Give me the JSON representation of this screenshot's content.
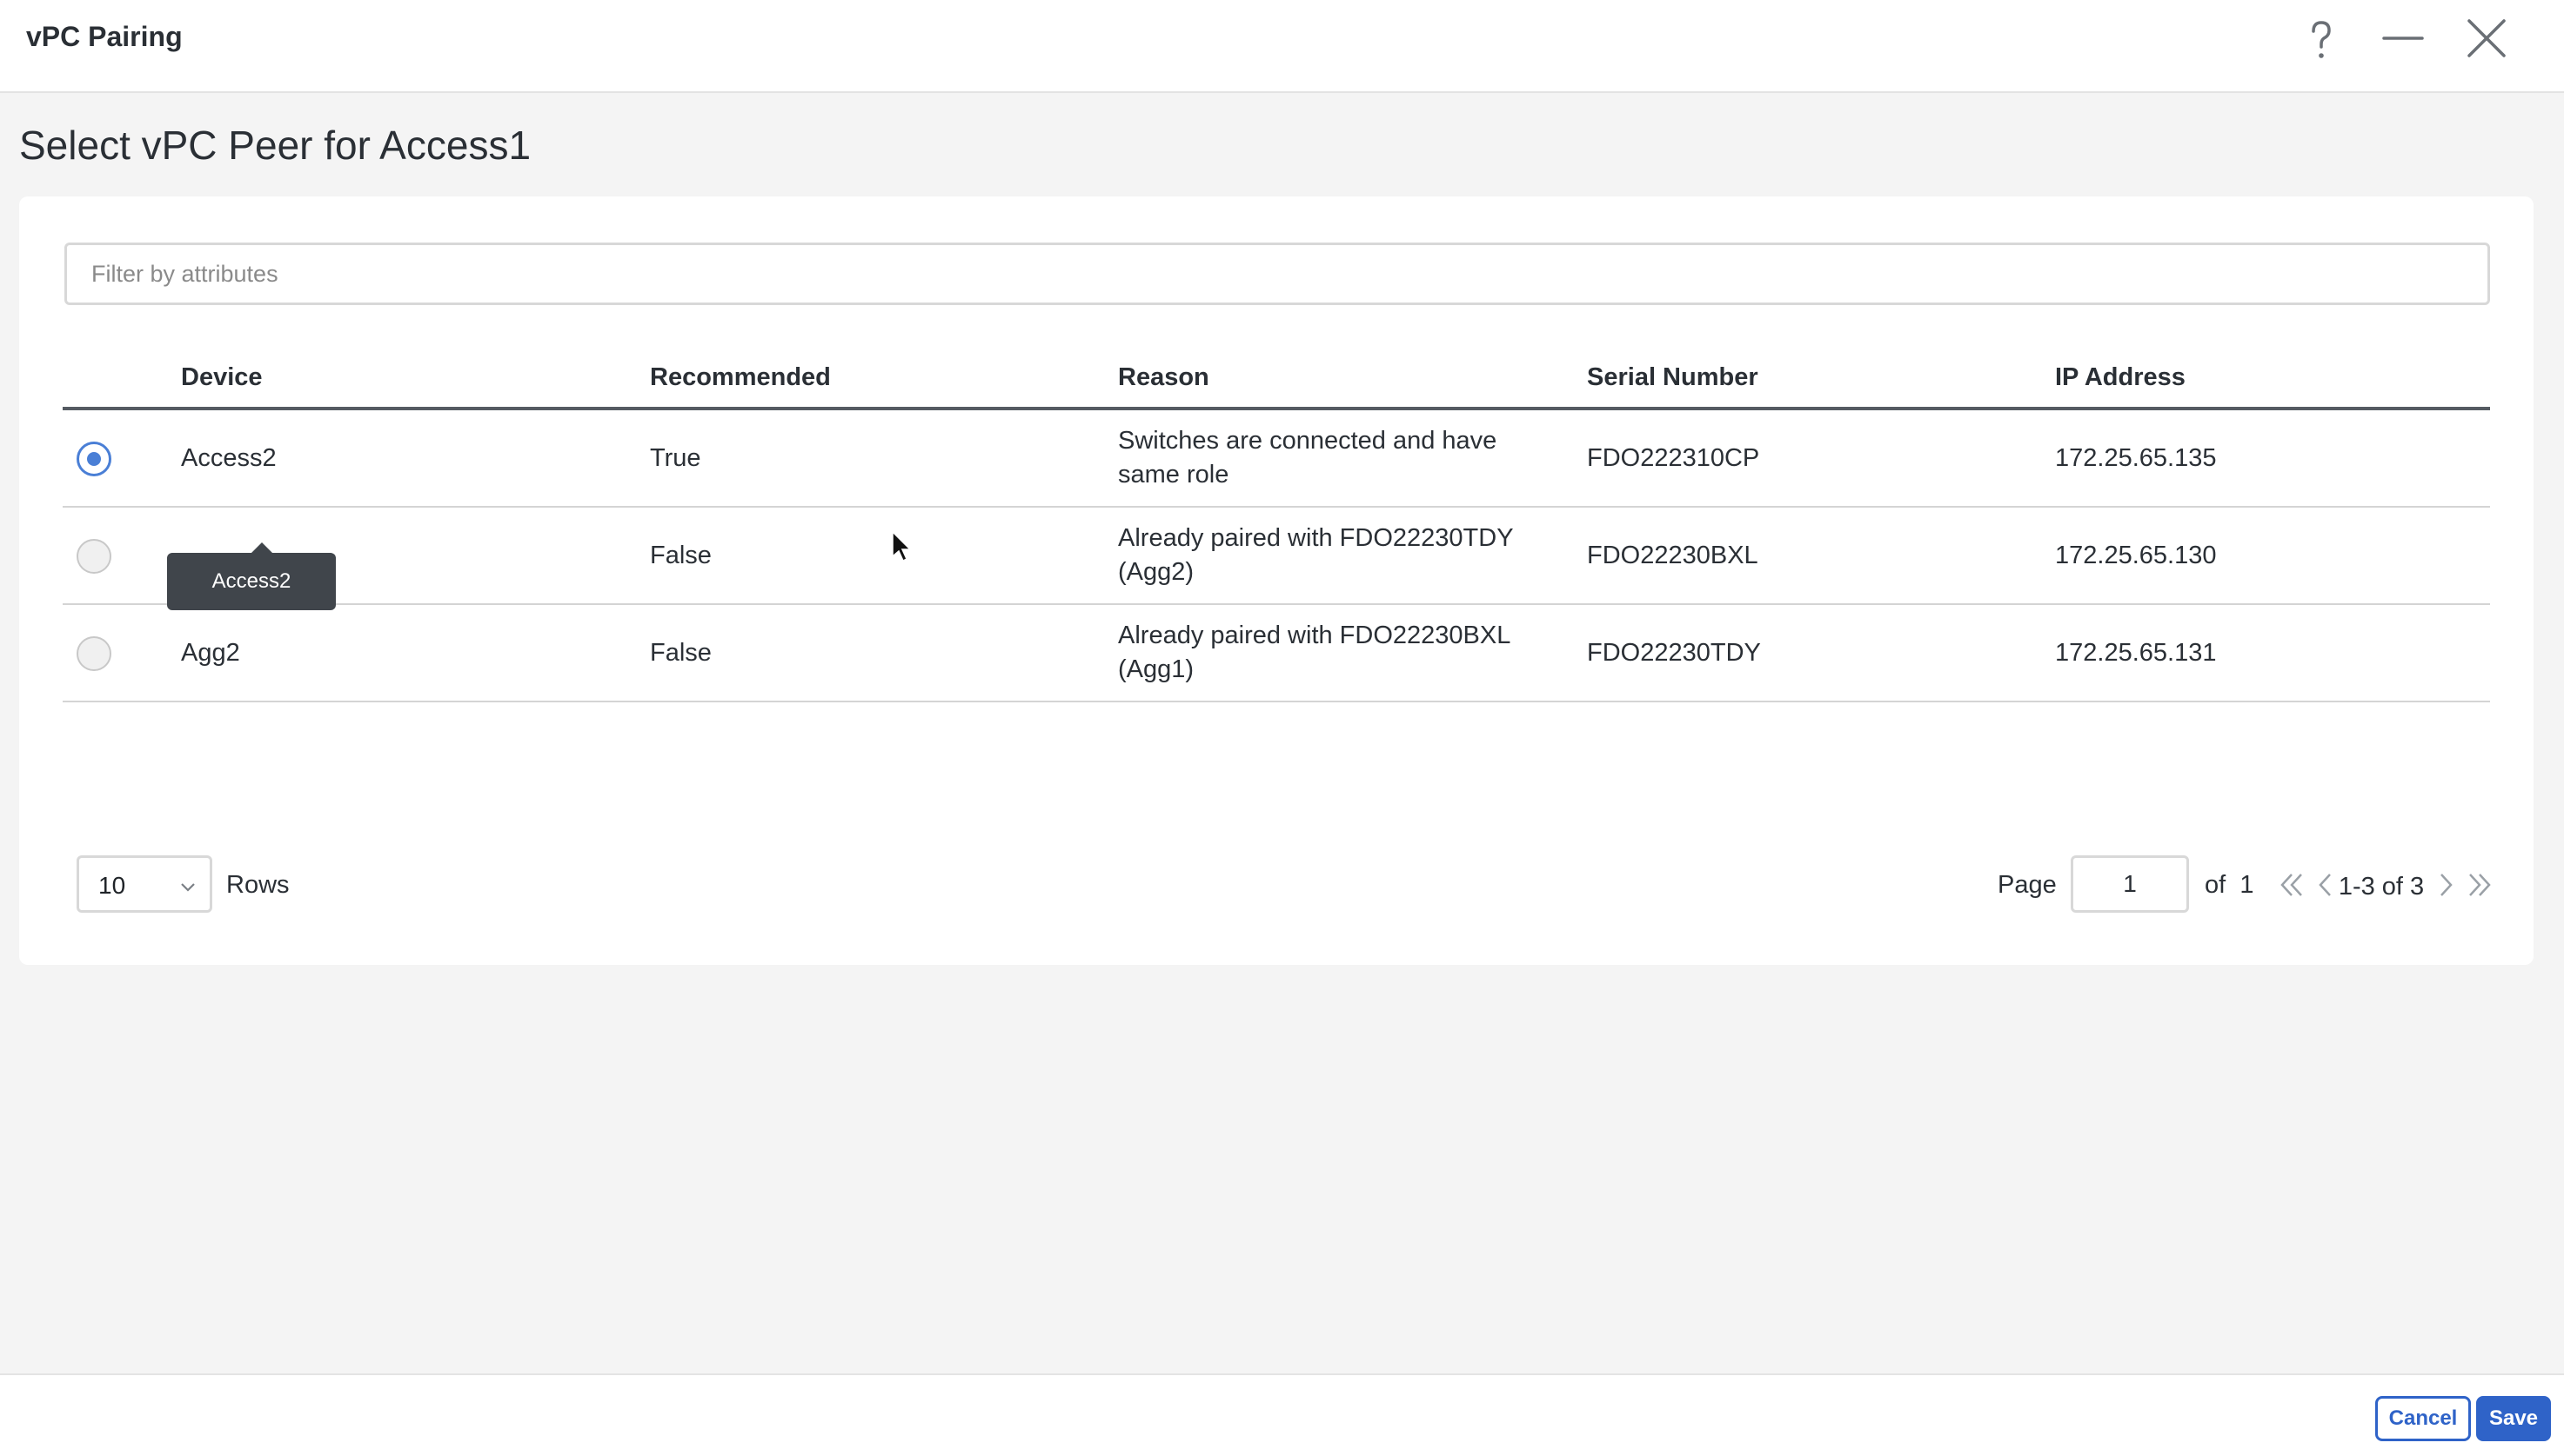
{
  "window": {
    "title": "vPC Pairing",
    "help_icon": "help-question-icon",
    "minimize_icon": "minimize-icon",
    "close_icon": "close-x-icon"
  },
  "heading": "Select vPC Peer for Access1",
  "filter": {
    "placeholder": "Filter by attributes",
    "value": ""
  },
  "table": {
    "columns": [
      "Device",
      "Recommended",
      "Reason",
      "Serial Number",
      "IP Address"
    ],
    "rows": [
      {
        "selected": true,
        "device": "Access2",
        "recommended": "True",
        "reason_line1": "Switches are connected and have",
        "reason_line2": "same role",
        "serial": "FDO222310CP",
        "ip": "172.25.65.135"
      },
      {
        "selected": false,
        "device": "",
        "recommended": "False",
        "reason_line1": "Already paired with FDO22230TDY",
        "reason_line2": "(Agg2)",
        "serial": "FDO22230BXL",
        "ip": "172.25.65.130"
      },
      {
        "selected": false,
        "device": "Agg2",
        "recommended": "False",
        "reason_line1": "Already paired with FDO22230BXL",
        "reason_line2": "(Agg1)",
        "serial": "FDO22230TDY",
        "ip": "172.25.65.131"
      }
    ],
    "tooltip": "Access2"
  },
  "pagination": {
    "rows_per_page": "10",
    "rows_label": "Rows",
    "page_label": "Page",
    "page_value": "1",
    "of_label": "of",
    "total_pages": "1",
    "range": "1-3 of 3"
  },
  "footer": {
    "cancel_label": "Cancel",
    "save_label": "Save"
  },
  "colors": {
    "accent": "#2f63c8",
    "radio_selected": "#4a7fd6"
  }
}
